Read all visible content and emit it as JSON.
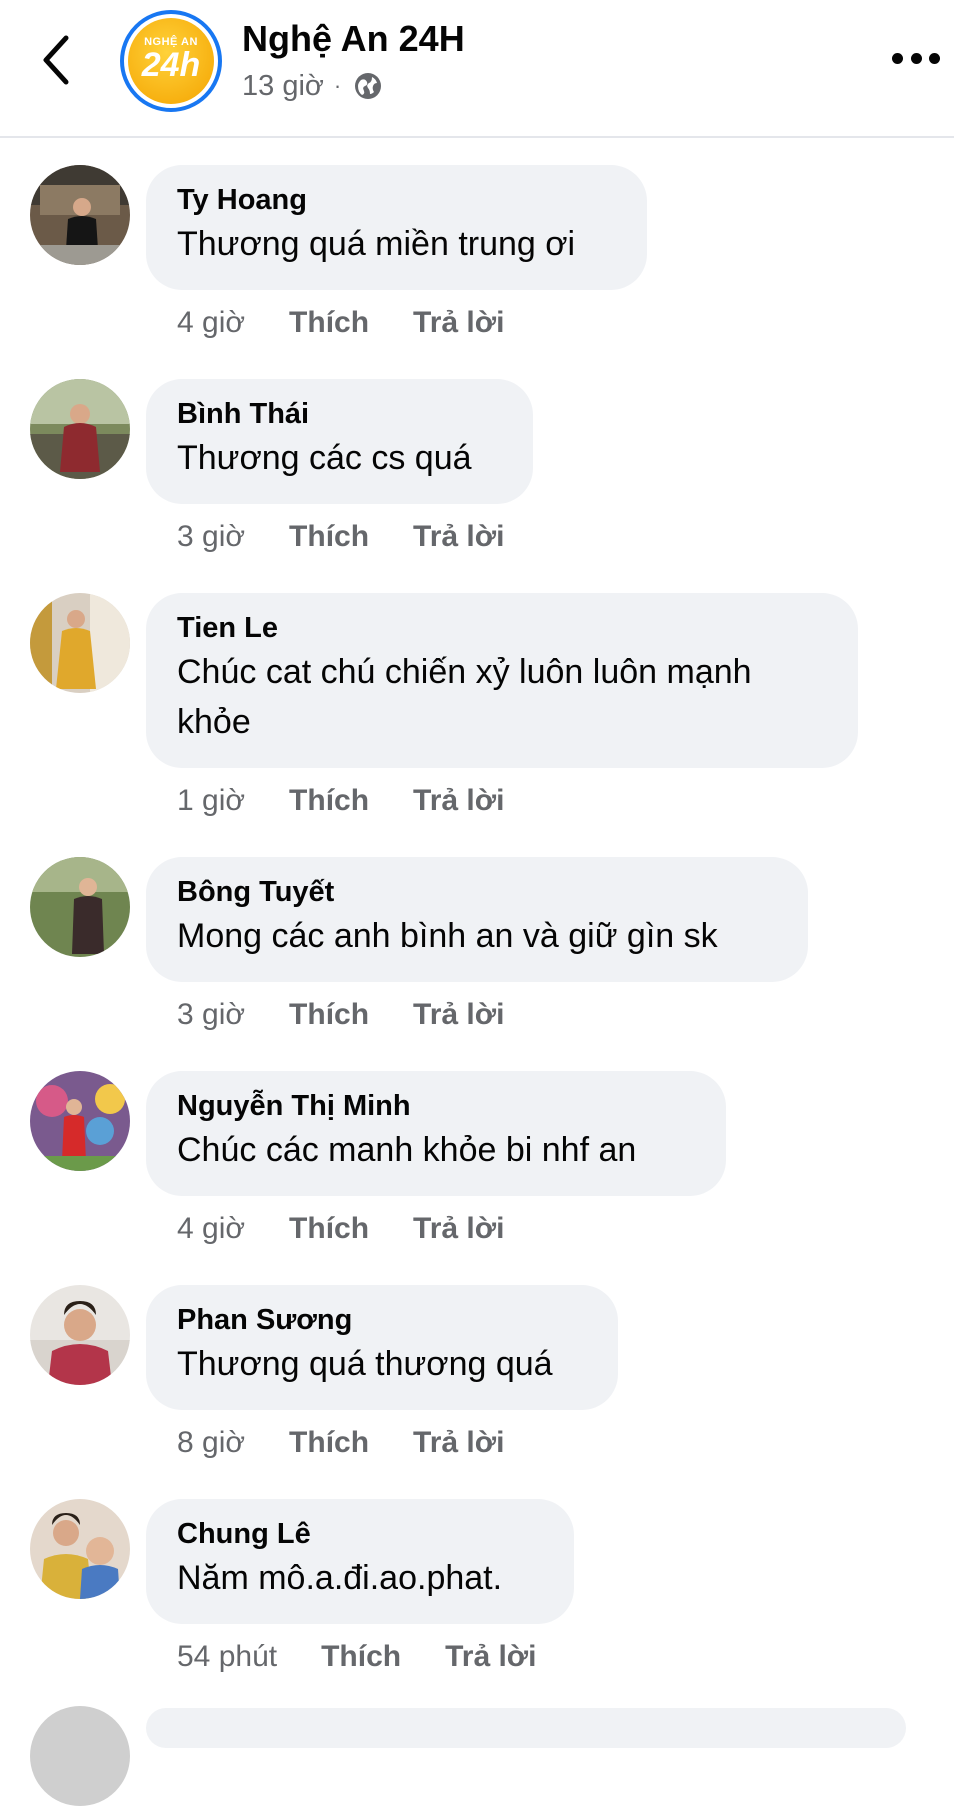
{
  "header": {
    "page_name": "Nghệ An 24H",
    "time": "13 giờ",
    "separator": "·",
    "logo_top": "NGHỆ AN",
    "logo_num": "24h",
    "brand_color": "#1877f2"
  },
  "comments": [
    {
      "author": "Ty Hoang",
      "text": "Thương quá miền trung ơi",
      "time": "4 giờ",
      "like": "Thích",
      "reply": "Trả lời"
    },
    {
      "author": "Bình Thái",
      "text": "Thương các cs quá",
      "time": "3 giờ",
      "like": "Thích",
      "reply": "Trả lời"
    },
    {
      "author": "Tien Le",
      "text": "Chúc cat chú chiến xỷ luôn luôn mạnh khỏe",
      "time": "1 giờ",
      "like": "Thích",
      "reply": "Trả lời"
    },
    {
      "author": "Bông Tuyết",
      "text": "Mong các anh bình an và giữ gìn sk",
      "time": "3 giờ",
      "like": "Thích",
      "reply": "Trả lời"
    },
    {
      "author": "Nguyễn Thị Minh",
      "text": "Chúc các manh khỏe bi nhf an",
      "time": "4 giờ",
      "like": "Thích",
      "reply": "Trả lời"
    },
    {
      "author": "Phan Sương",
      "text": "Thương quá thương quá",
      "time": "8 giờ",
      "like": "Thích",
      "reply": "Trả lời"
    },
    {
      "author": "Chung Lê",
      "text": "Năm mô.a.đi.ao.phat.",
      "time": "54 phút",
      "like": "Thích",
      "reply": "Trả lời"
    }
  ],
  "icons": {
    "back": "chevron-left-icon",
    "privacy": "globe-icon",
    "more": "more-horizontal-icon"
  }
}
